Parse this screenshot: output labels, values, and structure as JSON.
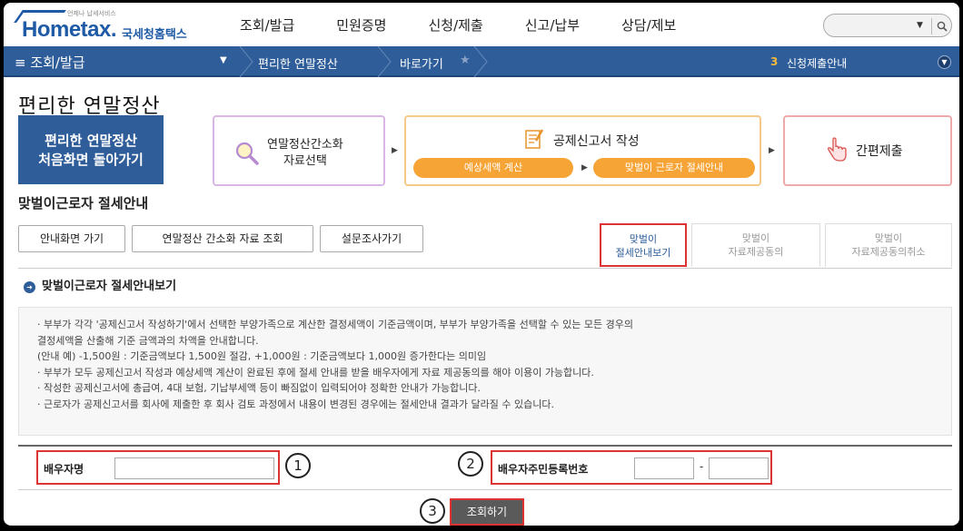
{
  "header": {
    "logo_tagline": "언제나 납세서비스",
    "logo_text": "Hometax.",
    "logo_kr": "국세청홈택스",
    "nav": [
      "조회/발급",
      "민원증명",
      "신청/제출",
      "신고/납부",
      "상담/제보"
    ],
    "search_placeholder": ""
  },
  "bluenav": {
    "menu": "≡ 조회/발급",
    "crumb1": "편리한 연말정산",
    "crumb2": "바로가기",
    "notice_num": "3",
    "notice": "신청제출안내"
  },
  "page_title": "편리한 연말정산",
  "home_button": [
    "편리한 연말정산",
    "처음화면 돌아가기"
  ],
  "steps": {
    "step1": [
      "연말정산간소화",
      "자료선택"
    ],
    "step2": {
      "title": "공제신고서 작성",
      "sub1": "예상세액 계산",
      "sub2": "맞벌이 근로자 절세안내"
    },
    "step3": "간편제출"
  },
  "section_title": "맞벌이근로자 절세안내",
  "buttons": [
    "안내화면 가기",
    "연말정산 간소화 자료 조회",
    "설문조사가기"
  ],
  "tabs": [
    [
      "맞벌이",
      "절세안내보기"
    ],
    [
      "맞벌이",
      "자료제공동의"
    ],
    [
      "맞벌이",
      "자료제공동의취소"
    ]
  ],
  "sub_title": "맞벌이근로자 절세안내보기",
  "info_lines": [
    "· 부부가 각각 '공제신고서 작성하기'에서 선택한 부양가족으로 계산한 결정세액이 기준금액이며, 부부가 부양가족을 선택할 수 있는 모든 경우의",
    "   결정세액을 산출해 기준 금액과의 차액을 안내합니다.",
    "   (안내 예) -1,500원 : 기준금액보다 1,500원 절감, +1,000원 : 기준금액보다 1,000원 증가한다는 의미임",
    "· 부부가 모두 공제신고서 작성과 예상세액 계산이 완료된 후에 절세 안내를 받을 배우자에게 자료 제공동의를 해야 이용이 가능합니다.",
    "· 작성한 공제신고서에 총급여, 4대 보험, 기납부세액 등이 빠짐없이 입력되어야 정확한 안내가 가능합니다.",
    "· 근로자가 공제신고서를 회사에 제출한 후 회사 검토 과정에서 내용이 변경된 경우에는 절세안내 결과가 달라질 수 있습니다."
  ],
  "form": {
    "spouse_name_label": "배우자명",
    "spouse_rrn_label": "배우자주민등록번호",
    "rrn_dash": "-",
    "spouse_name_value": "",
    "rrn_front_value": "",
    "rrn_back_value": ""
  },
  "markers": [
    "1",
    "2",
    "3"
  ],
  "submit_label": "조회하기"
}
